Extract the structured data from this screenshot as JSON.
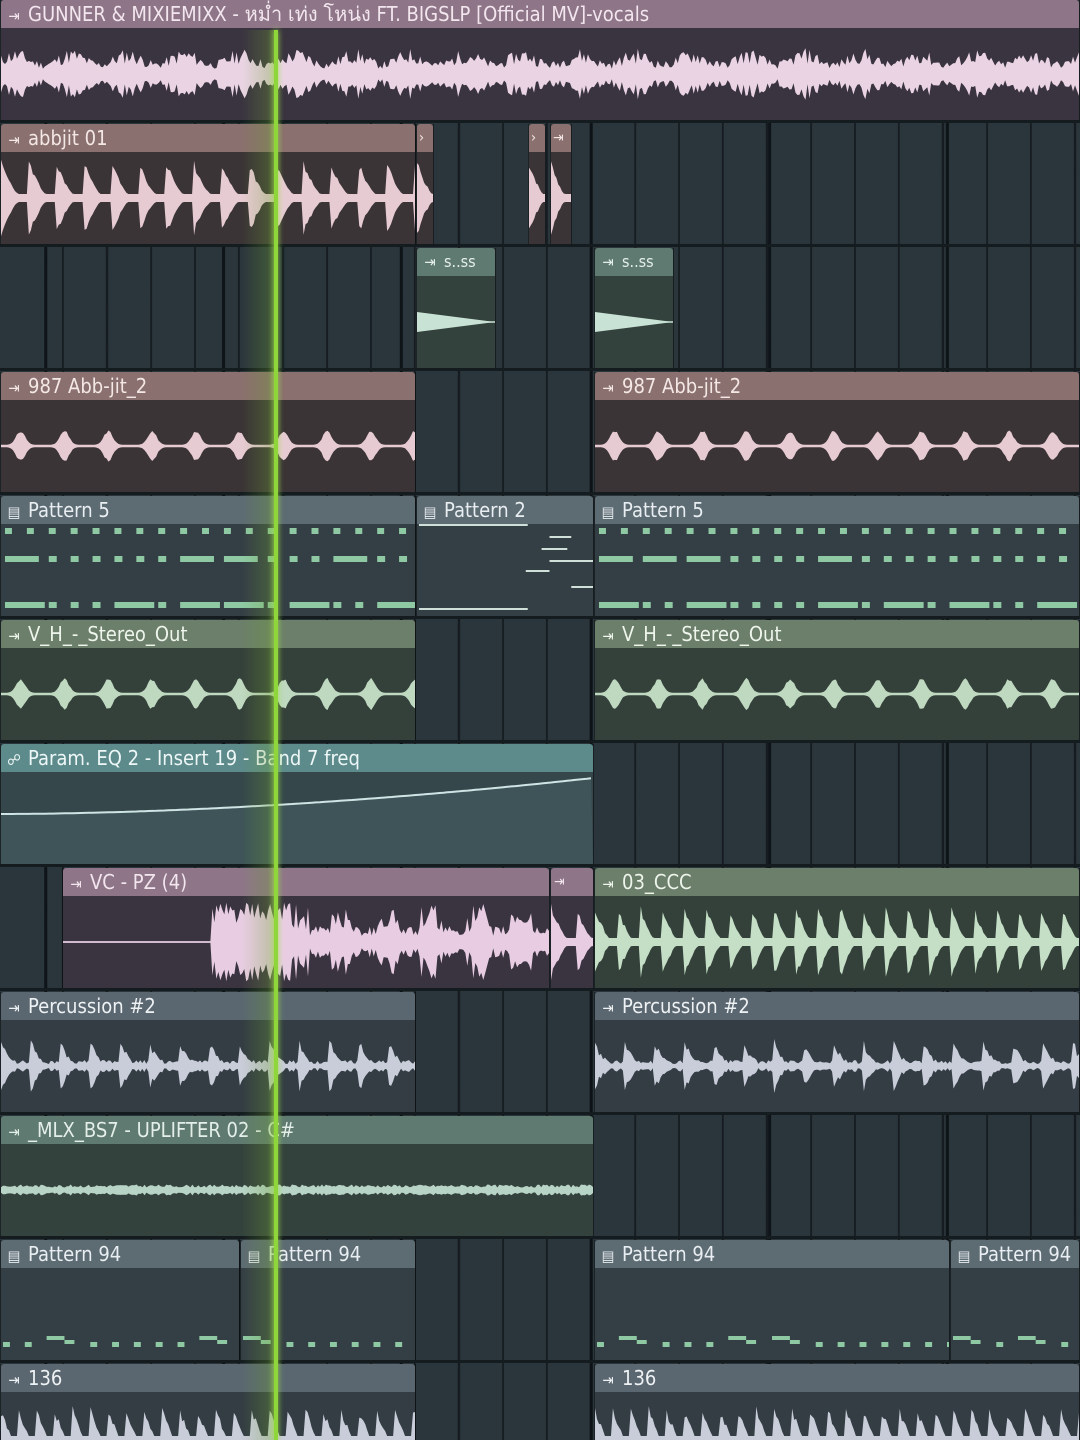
{
  "app": "FL Studio",
  "view": "Playlist",
  "colors": {
    "playhead": "#8fd63a",
    "vocals_wave": "#ead4e4",
    "brown_wave": "#e7cbd3",
    "green_wave": "#bfd8c0",
    "grey_wave": "#c9ccd9",
    "pattern_notes": "#8fc9a4",
    "automation_curve": "#cfe4e4"
  },
  "icons": {
    "audio_clip": "audio-clip-arrow-icon",
    "pattern_clip": "pattern-grid-icon",
    "automation_clip": "automation-link-icon"
  },
  "clips": {
    "vocals": "GUNNER & MIXIEMIXX - หม่ำ เท่ง โหน่ง FT. BIGSLP [Official MV]-vocals",
    "abbjit": "abbjit 01",
    "sss_1": "s..ss",
    "sss_2": "s..ss",
    "abb_jit_left": "987 Abb-jit_2",
    "abb_jit_right": "987 Abb-jit_2",
    "pattern5_left": "Pattern 5",
    "pattern2": "Pattern 2",
    "pattern5_right": "Pattern 5",
    "stereo_left": "V_H_-_Stereo_Out",
    "stereo_right": "V_H_-_Stereo_Out",
    "automation": "Param. EQ 2 - Insert 19 - Band 7 freq",
    "vc_pz": "VC - PZ (4)",
    "ccc": "03_CCC",
    "perc_left": "Percussion #2",
    "perc_right": "Percussion #2",
    "uplifter": "_MLX_BS7 - UPLIFTER 02 - C#",
    "p94_a": "Pattern 94",
    "p94_b": "Pattern 94",
    "p94_c": "Pattern 94",
    "p94_d": "Pattern 94",
    "bpm_left": "136",
    "bpm_right": "136"
  }
}
